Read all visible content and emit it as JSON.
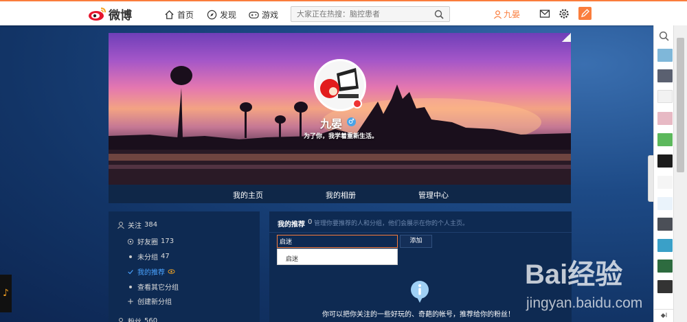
{
  "brand": {
    "name": "微博",
    "accent": "#fa7d3c"
  },
  "topnav": {
    "home": "首页",
    "discover": "发现",
    "games": "游戏",
    "search_placeholder": "大家正在热搜：脑控患者",
    "username": "九晏"
  },
  "profile": {
    "name": "九晏",
    "bio": "为了你，我学着重新生活。"
  },
  "tabs": [
    "我的主页",
    "我的相册",
    "管理中心"
  ],
  "sidebar": {
    "follow_label": "关注",
    "follow_count": "384",
    "items": [
      {
        "label": "好友圈",
        "count": "173"
      },
      {
        "label": "未分组",
        "count": "47"
      },
      {
        "label": "我的推荐"
      },
      {
        "label": "查看其它分组"
      },
      {
        "label": "创建新分组"
      }
    ],
    "fans_label": "粉丝",
    "fans_count": "560"
  },
  "recommend": {
    "title": "我的推荐",
    "count": "0",
    "desc": "管理你要推荐的人和分组，他们会展示在你的个人主页。",
    "input_value": "启迷",
    "add_label": "添加",
    "suggestion": "启迷",
    "empty_message": "你可以把你关注的一些好玩的、奇葩的帐号，推荐给你的粉丝！"
  },
  "watermark": {
    "brand": "Bai经验",
    "url": "jingyan.baidu.com"
  }
}
